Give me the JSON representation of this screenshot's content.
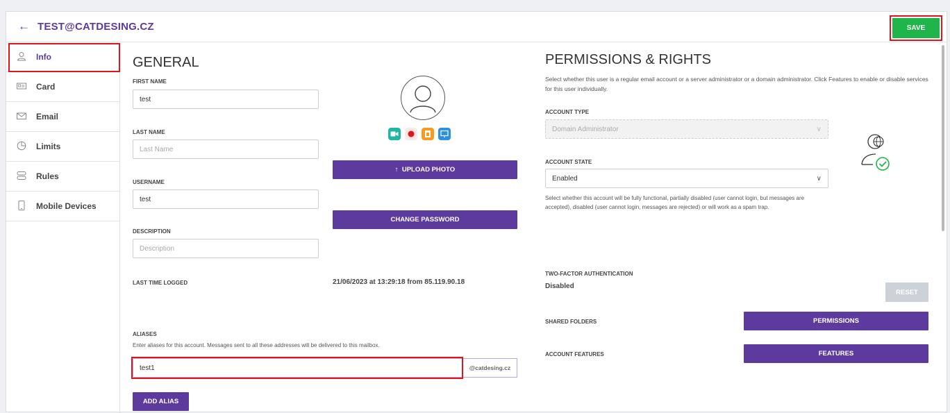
{
  "header": {
    "back_icon": "arrow-left-icon",
    "title": "TEST@CATDESING.CZ",
    "save_label": "SAVE"
  },
  "sidebar": {
    "items": [
      {
        "label": "Info",
        "icon": "user-icon",
        "active": true
      },
      {
        "label": "Card",
        "icon": "id-card-icon"
      },
      {
        "label": "Email",
        "icon": "envelope-icon"
      },
      {
        "label": "Limits",
        "icon": "pie-chart-icon"
      },
      {
        "label": "Rules",
        "icon": "rules-icon"
      },
      {
        "label": "Mobile Devices",
        "icon": "mobile-icon"
      }
    ]
  },
  "general": {
    "heading": "GENERAL",
    "first_name": {
      "label": "FIRST NAME",
      "value": "test"
    },
    "last_name": {
      "label": "LAST NAME",
      "placeholder": "Last Name"
    },
    "username": {
      "label": "USERNAME",
      "value": "test"
    },
    "description": {
      "label": "DESCRIPTION",
      "placeholder": "Description"
    },
    "last_logged": {
      "label": "LAST TIME LOGGED",
      "value": "21/06/2023 at 13:29:18 from 85.119.90.18"
    },
    "upload_photo": "UPLOAD PHOTO",
    "change_password": "CHANGE PASSWORD",
    "aliases": {
      "label": "ALIASES",
      "description": "Enter aliases for this account. Messages sent to all these addresses will be delivered to this mailbox.",
      "value": "test1",
      "suffix": "@catdesing.cz",
      "add_label": "ADD ALIAS"
    }
  },
  "permissions": {
    "heading": "PERMISSIONS & RIGHTS",
    "intro": "Select whether this user is a regular email account or a server administrator or a domain administrator. Click Features to enable or disable services for this user individually.",
    "account_type": {
      "label": "ACCOUNT TYPE",
      "value": "Domain Administrator"
    },
    "account_state": {
      "label": "ACCOUNT STATE",
      "value": "Enabled",
      "description": "Select whether this account will be fully functional, partially disabled (user cannot login, but messages are accepted), disabled (user cannot login, messages are rejected) or will work as a spam trap."
    },
    "two_factor": {
      "label": "TWO-FACTOR AUTHENTICATION",
      "value": "Disabled",
      "reset_label": "RESET"
    },
    "shared_folders": {
      "label": "SHARED FOLDERS",
      "button": "PERMISSIONS"
    },
    "account_features": {
      "label": "ACCOUNT FEATURES",
      "button": "FEATURES"
    }
  },
  "colors": {
    "accent": "#5c3a9e",
    "save": "#20b54a",
    "highlight": "#e0151c"
  }
}
